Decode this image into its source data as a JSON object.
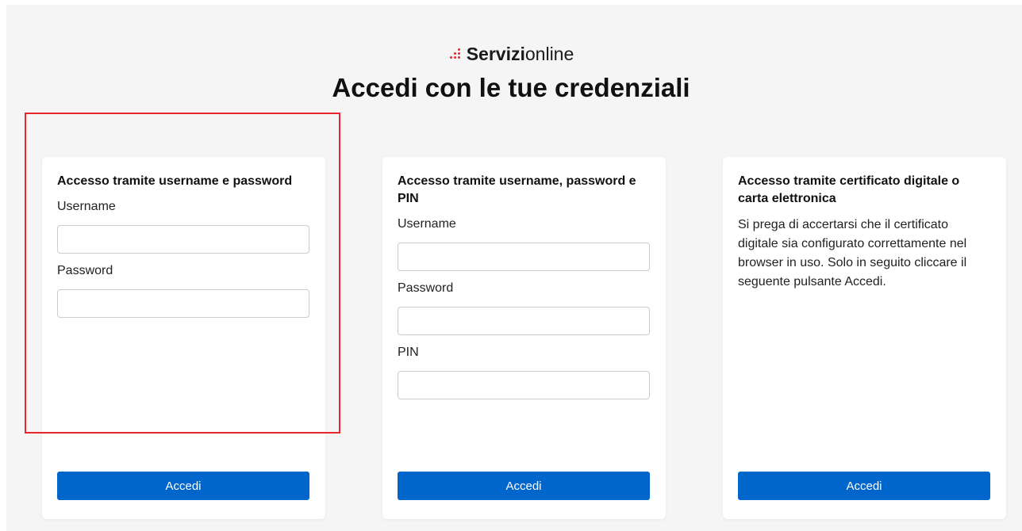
{
  "brand": {
    "name_bold": "Servizi",
    "name_rest": "online",
    "dot_colors": [
      "#e8262f",
      "#1f5fa8"
    ]
  },
  "page": {
    "title": "Accedi con le tue credenziali"
  },
  "cards": [
    {
      "title": "Accesso tramite username e password",
      "username_label": "Username",
      "username_value": "",
      "password_label": "Password",
      "password_value": "",
      "button_label": "Accedi"
    },
    {
      "title": "Accesso tramite username, password e PIN",
      "username_label": "Username",
      "username_value": "",
      "password_label": "Password",
      "password_value": "",
      "pin_label": "PIN",
      "pin_value": "",
      "button_label": "Accedi"
    },
    {
      "title": "Accesso tramite certificato digitale o carta elettronica",
      "description": "Si prega di accertarsi che il certificato digitale sia configurato correttamente nel browser in uso. Solo in seguito cliccare il seguente pulsante Accedi.",
      "button_label": "Accedi"
    }
  ],
  "colors": {
    "accent": "#0066cc",
    "highlight": "#e8262f",
    "background": "#f5f5f5"
  }
}
